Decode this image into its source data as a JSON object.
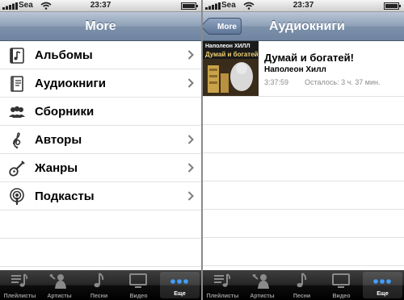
{
  "status_bar": {
    "carrier": "Sea",
    "time": "23:37"
  },
  "left": {
    "nav_title": "More",
    "items": [
      {
        "label": "Альбомы",
        "icon": "album-icon"
      },
      {
        "label": "Аудиокниги",
        "icon": "audiobook-icon"
      },
      {
        "label": "Сборники",
        "icon": "compilations-icon"
      },
      {
        "label": "Авторы",
        "icon": "composers-icon"
      },
      {
        "label": "Жанры",
        "icon": "genres-icon"
      },
      {
        "label": "Подкасты",
        "icon": "podcasts-icon"
      }
    ]
  },
  "right": {
    "back_label": "More",
    "nav_title": "Аудиокниги",
    "book": {
      "title": "Думай и богатей!",
      "author": "Наполеон Хилл",
      "duration": "3:37:59",
      "remaining": "Осталось: 3 ч. 37 мин.",
      "cover_author": "Наполеон ХИЛЛ",
      "cover_title": "Думай и богатей!"
    }
  },
  "tabs": [
    {
      "label": "Плейлисты",
      "icon": "playlists-icon"
    },
    {
      "label": "Артисты",
      "icon": "artists-icon"
    },
    {
      "label": "Песни",
      "icon": "songs-icon"
    },
    {
      "label": "Видео",
      "icon": "video-icon"
    },
    {
      "label": "Еще",
      "icon": "more-icon",
      "selected": true
    }
  ]
}
